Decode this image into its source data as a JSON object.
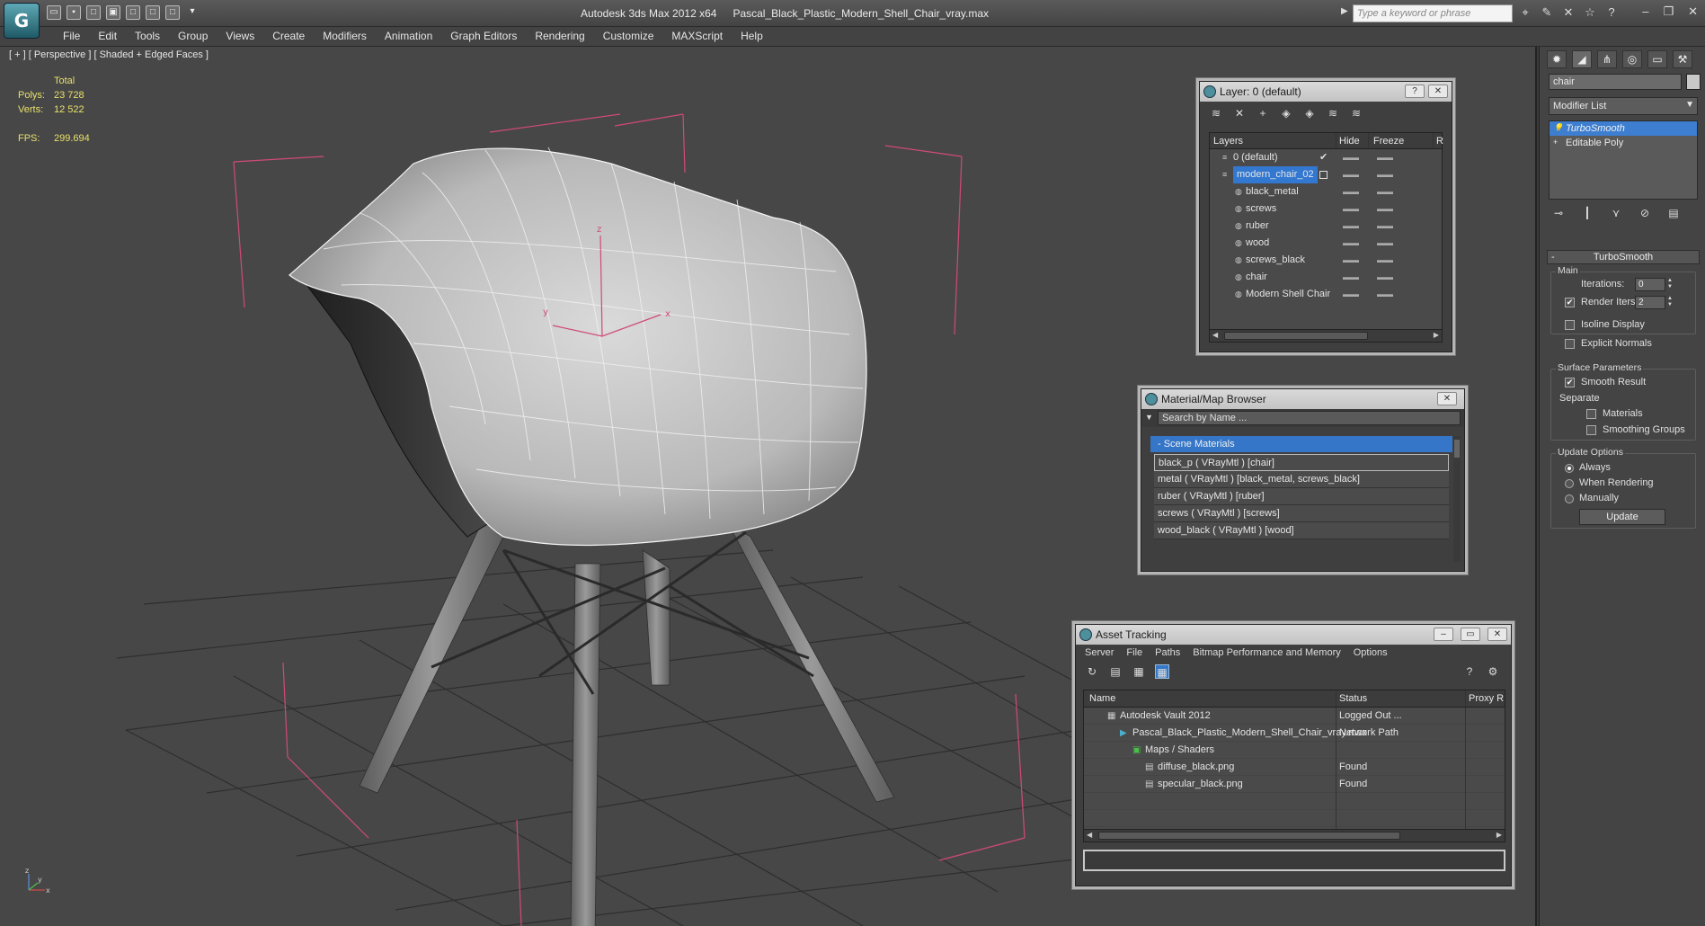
{
  "app": {
    "logo": "G",
    "title": "Autodesk 3ds Max  2012 x64",
    "filename": "Pascal_Black_Plastic_Modern_Shell_Chair_vray.max",
    "search_placeholder": "Type a keyword or phrase"
  },
  "menu": [
    "File",
    "Edit",
    "Tools",
    "Group",
    "Views",
    "Create",
    "Modifiers",
    "Animation",
    "Graph Editors",
    "Rendering",
    "Customize",
    "MAXScript",
    "Help"
  ],
  "viewport": {
    "label": "[ + ] [ Perspective ] [ Shaded + Edged Faces ]",
    "stats": {
      "header": "Total",
      "polys_label": "Polys:",
      "polys": "23 728",
      "verts_label": "Verts:",
      "verts": "12 522",
      "fps_label": "FPS:",
      "fps": "299.694"
    },
    "gizmo": {
      "x": "x",
      "y": "y",
      "z": "z"
    }
  },
  "command_panel": {
    "object_name": "chair",
    "modifier_list": "Modifier List",
    "stack": [
      {
        "label": "TurboSmooth",
        "selected": true
      },
      {
        "label": "Editable Poly",
        "selected": false
      }
    ],
    "rollout_title": "TurboSmooth",
    "main_label": "Main",
    "iterations_label": "Iterations:",
    "iterations": "0",
    "render_iters_label": "Render Iters:",
    "render_iters": "2",
    "render_iters_checked": true,
    "isoline_label": "Isoline Display",
    "explicit_normals_label": "Explicit Normals",
    "surface_params_label": "Surface Parameters",
    "smooth_result_label": "Smooth Result",
    "separate_label": "Separate",
    "materials_label": "Materials",
    "smoothing_groups_label": "Smoothing Groups",
    "update_options_label": "Update Options",
    "always_label": "Always",
    "when_rendering_label": "When Rendering",
    "manually_label": "Manually",
    "update_button": "Update"
  },
  "layer_window": {
    "title": "Layer: 0 (default)",
    "col_layers": "Layers",
    "col_hide": "Hide",
    "col_freeze": "Freeze",
    "col_r": "R",
    "rows": [
      {
        "name": "0 (default)",
        "indent": 1,
        "selected": false
      },
      {
        "name": "modern_chair_02",
        "indent": 1,
        "selected": true
      },
      {
        "name": "black_metal",
        "indent": 2,
        "selected": false
      },
      {
        "name": "screws",
        "indent": 2,
        "selected": false
      },
      {
        "name": "ruber",
        "indent": 2,
        "selected": false
      },
      {
        "name": "wood",
        "indent": 2,
        "selected": false
      },
      {
        "name": "screws_black",
        "indent": 2,
        "selected": false
      },
      {
        "name": "chair",
        "indent": 2,
        "selected": false
      },
      {
        "name": "Modern Shell Chair",
        "indent": 2,
        "selected": false
      }
    ]
  },
  "material_browser": {
    "title": "Material/Map Browser",
    "search_placeholder": "Search by Name ...",
    "section": "- Scene Materials",
    "rows": [
      "black_p  ( VRayMtl ) [chair]",
      "metal  ( VRayMtl ) [black_metal, screws_black]",
      "ruber  ( VRayMtl ) [ruber]",
      "screws  ( VRayMtl ) [screws]",
      "wood_black  ( VRayMtl ) [wood]"
    ]
  },
  "asset_tracking": {
    "title": "Asset Tracking",
    "menu": [
      "Server",
      "File",
      "Paths",
      "Bitmap Performance and Memory",
      "Options"
    ],
    "col_name": "Name",
    "col_status": "Status",
    "col_proxy": "Proxy R",
    "rows": [
      {
        "name": "Autodesk Vault 2012",
        "status": "Logged Out ...",
        "indent": 1
      },
      {
        "name": "Pascal_Black_Plastic_Modern_Shell_Chair_vray.max",
        "status": "Network Path",
        "indent": 2
      },
      {
        "name": "Maps / Shaders",
        "status": "",
        "indent": 3
      },
      {
        "name": "diffuse_black.png",
        "status": "Found",
        "indent": 4
      },
      {
        "name": "specular_black.png",
        "status": "Found",
        "indent": 4
      }
    ]
  },
  "colors": {
    "selection": "#3378d0",
    "bbox": "#d04a78",
    "stats": "#e8e06a"
  }
}
